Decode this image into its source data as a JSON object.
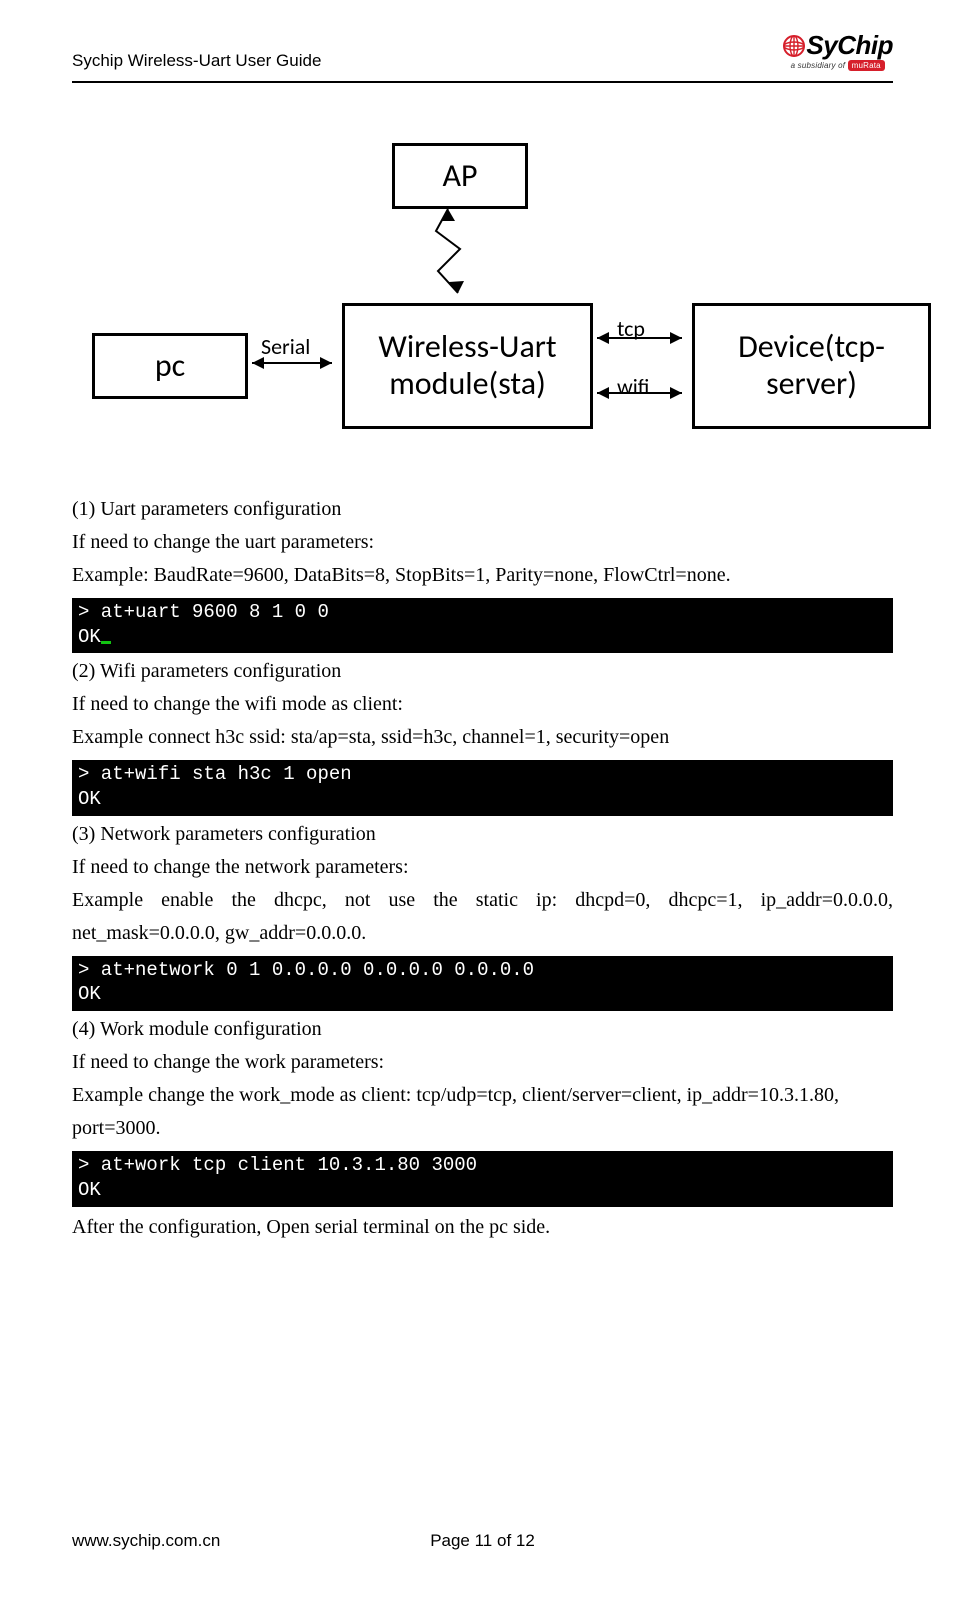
{
  "header": {
    "title": "Sychip Wireless-Uart User Guide",
    "logo_text": "SyChip",
    "logo_sub_prefix": "a subsidiary of ",
    "logo_sub_brand": "muRata"
  },
  "diagram": {
    "ap": "AP",
    "pc": "pc",
    "wu_line1": "Wireless-Uart",
    "wu_line2": "module(sta)",
    "dv_line1": "Device(tcp-",
    "dv_line2": "server)",
    "label_serial": "Serial",
    "label_tcp": "tcp",
    "label_wifi": "wifi"
  },
  "sections": [
    {
      "head": "(1)  Uart parameters configuration",
      "intro": "If need to change the uart parameters:",
      "example": "Example: BaudRate=9600, DataBits=8, StopBits=1, Parity=none, FlowCtrl=none.",
      "term_lines": [
        "> at+uart 9600 8 1 0 0",
        "OK"
      ],
      "cursor_after_ok": true
    },
    {
      "head": "(2)  Wifi parameters configuration",
      "intro": "If need to change the wifi mode as client:",
      "example": "Example connect h3c ssid: sta/ap=sta, ssid=h3c, channel=1, security=open",
      "term_lines": [
        "> at+wifi sta h3c 1 open",
        "OK"
      ],
      "cursor_after_ok": false
    },
    {
      "head": "(3)  Network parameters configuration",
      "intro": "If need to change the network parameters:",
      "example": "Example enable the dhcpc, not use the static ip: dhcpd=0, dhcpc=1, ip_addr=0.0.0.0, net_mask=0.0.0.0, gw_addr=0.0.0.0.",
      "term_lines": [
        "> at+network 0 1 0.0.0.0 0.0.0.0 0.0.0.0",
        "OK"
      ],
      "cursor_after_ok": false
    },
    {
      "head": "(4)  Work module configuration",
      "intro": "If need to change the work parameters:",
      "example": "Example change the work_mode as client: tcp/udp=tcp, client/server=client, ip_addr=10.3.1.80, port=3000.",
      "term_lines": [
        "> at+work tcp client 10.3.1.80 3000",
        "OK"
      ],
      "cursor_after_ok": false
    }
  ],
  "closing": "After the configuration, Open serial terminal on the pc side.",
  "footer": {
    "url": "www.sychip.com.cn",
    "page": "Page 11 of 12"
  }
}
